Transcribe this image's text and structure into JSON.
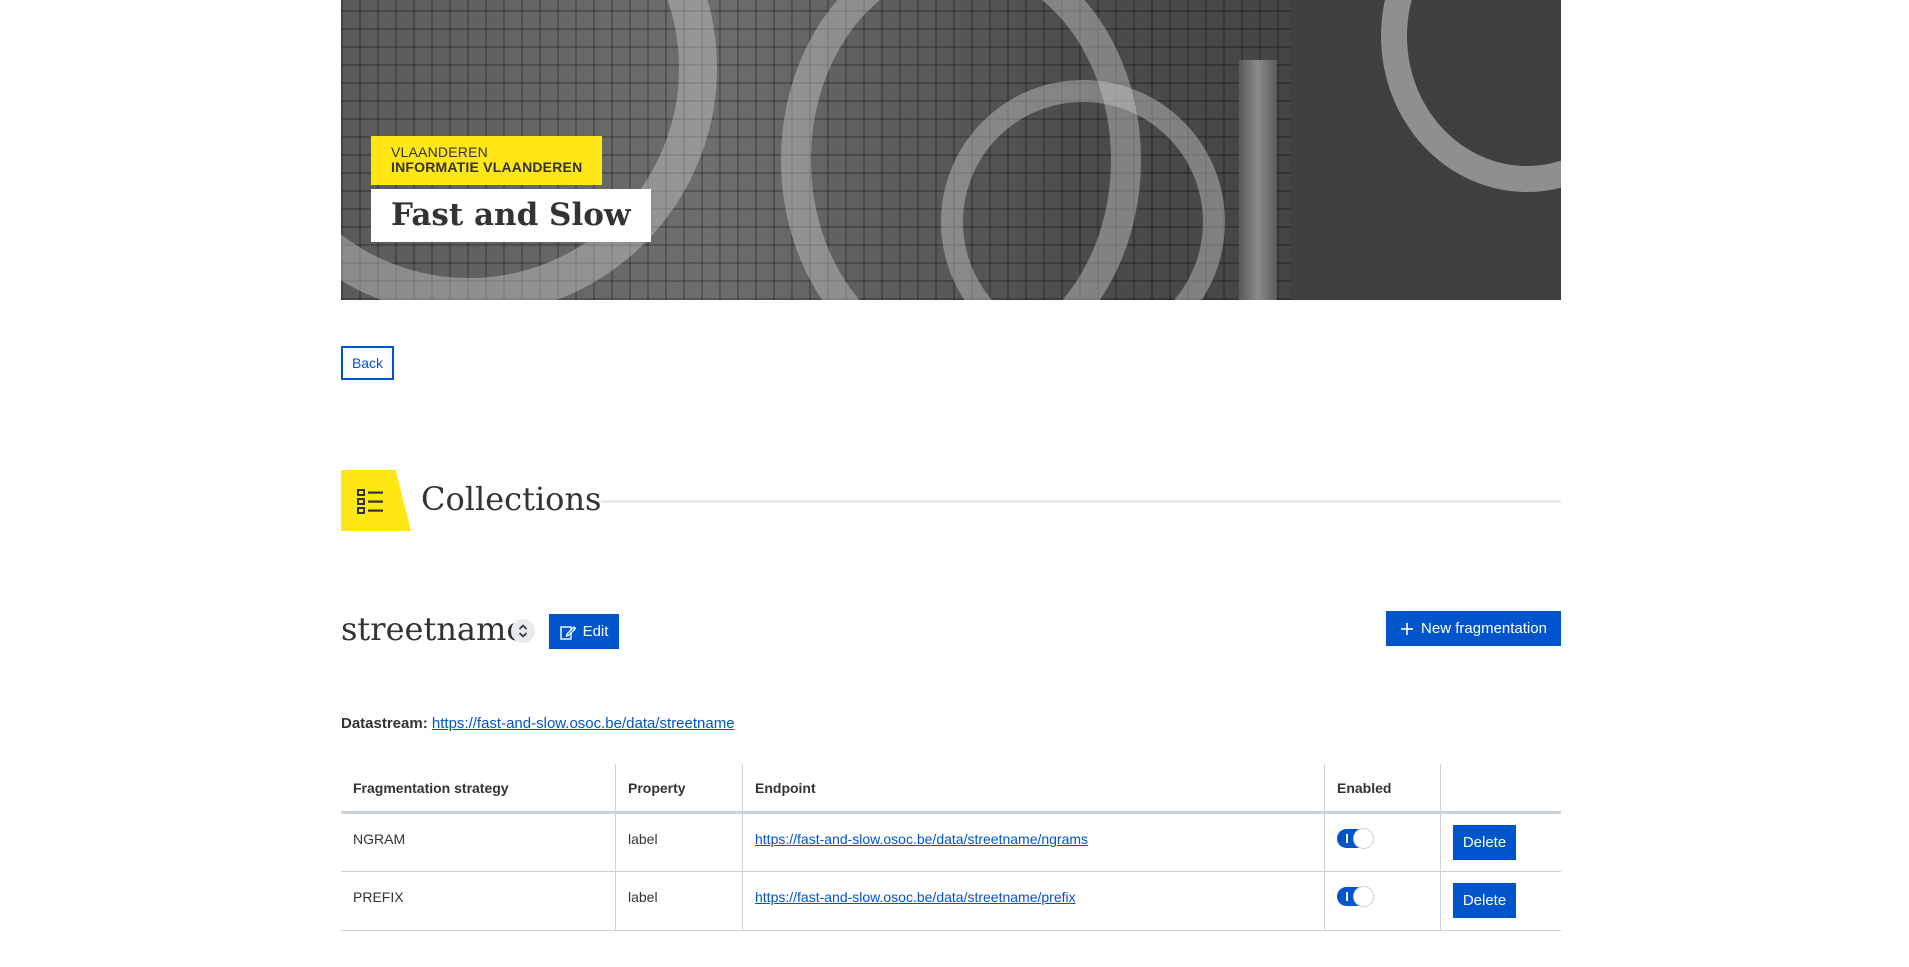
{
  "hero": {
    "org_top": "VLAANDEREN",
    "org_bottom": "INFORMATIE VLAANDEREN",
    "title": "Fast and Slow"
  },
  "nav": {
    "back_label": "Back"
  },
  "section": {
    "title": "Collections",
    "icon": "list-icon"
  },
  "collection": {
    "name": "streetname",
    "edit_label": "Edit",
    "new_fragmentation_label": "New fragmentation",
    "datastream_label": "Datastream:",
    "datastream_url": "https://fast-and-slow.osoc.be/data/streetname"
  },
  "table": {
    "headers": [
      "Fragmentation strategy",
      "Property",
      "Endpoint",
      "Enabled",
      ""
    ],
    "rows": [
      {
        "strategy": "NGRAM",
        "property": "label",
        "endpoint": "https://fast-and-slow.osoc.be/data/streetname/ngrams",
        "enabled": true,
        "delete_label": "Delete"
      },
      {
        "strategy": "PREFIX",
        "property": "label",
        "endpoint": "https://fast-and-slow.osoc.be/data/streetname/prefix",
        "enabled": true,
        "delete_label": "Delete"
      }
    ]
  },
  "colors": {
    "accent_yellow": "#ffe615",
    "primary_blue": "#0055cc",
    "text": "#333332"
  }
}
